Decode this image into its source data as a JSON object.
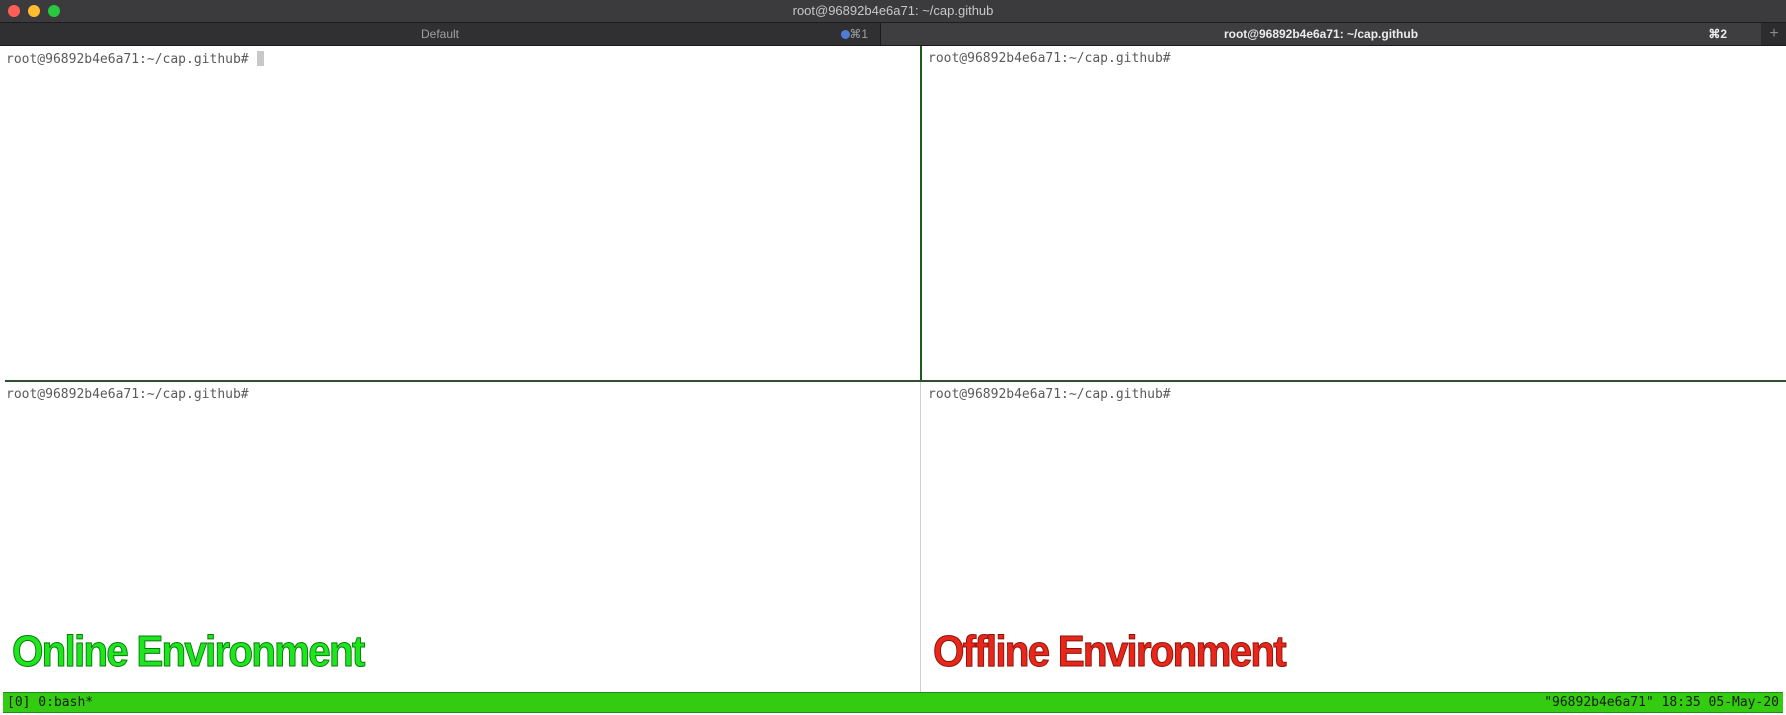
{
  "window": {
    "title": "root@96892b4e6a71: ~/cap.github"
  },
  "tabs": [
    {
      "label": "Default",
      "shortcut": "⌘1",
      "active": false
    },
    {
      "label": "root@96892b4e6a71: ~/cap.github",
      "shortcut": "⌘2",
      "active": true
    }
  ],
  "new_tab_glyph": "+",
  "panes": {
    "top_left_prompt": "root@96892b4e6a71:~/cap.github#",
    "top_right_prompt": "root@96892b4e6a71:~/cap.github#",
    "bottom_left_prompt": "root@96892b4e6a71:~/cap.github#",
    "bottom_right_prompt": "root@96892b4e6a71:~/cap.github#"
  },
  "labels": {
    "online": "Online Environment",
    "offline": "Offline Environment"
  },
  "status": {
    "left": "[0] 0:bash*",
    "right": "\"96892b4e6a71\" 18:35 05-May-20"
  },
  "colors": {
    "status_bar": "#33cc11",
    "online_label": "#1ee61e",
    "offline_label": "#e8261a",
    "tab_dot": "#4f7cd6"
  }
}
